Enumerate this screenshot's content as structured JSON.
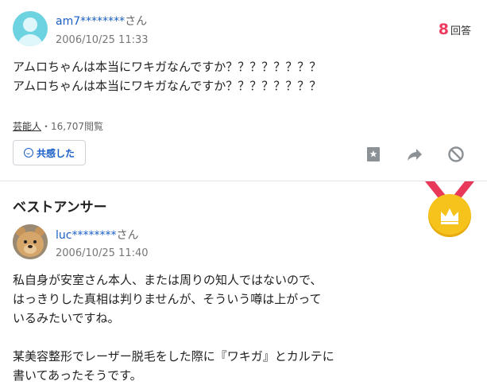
{
  "question": {
    "user": {
      "name": "am7********",
      "suffix": "さん"
    },
    "date": "2006/10/25 11:33",
    "answers": {
      "count": "8",
      "label": "回答"
    },
    "body": "アムロちゃんは本当にワキガなんですか？？？？？？？？\nアムロちゃんは本当にワキガなんですか？？？？？？？？",
    "category": "芸能人",
    "views": "・16,707閲覧",
    "empathy_label": "共感した"
  },
  "best_answer": {
    "title": "ベストアンサー",
    "user": {
      "name": "luc********",
      "suffix": "さん"
    },
    "date": "2006/10/25 11:40",
    "body": "私自身が安室さん本人、または周りの知人ではないので、\nはっきりした真相は判りませんが、そういう噂は上がって\nいるみたいですね。\n\n某美容整形でレーザー脱毛をした際に『ワキガ』とカルテに\n書いてあったそうです。"
  },
  "icons": {
    "bookmark": "bookmark-icon",
    "share": "share-arrow-icon",
    "block": "block-icon",
    "medal": "crown-medal-icon"
  },
  "colors": {
    "link": "#1a5fc6",
    "accent": "#ee3b5f",
    "medal": "#f6c21c",
    "ribbon": "#e8395a"
  }
}
